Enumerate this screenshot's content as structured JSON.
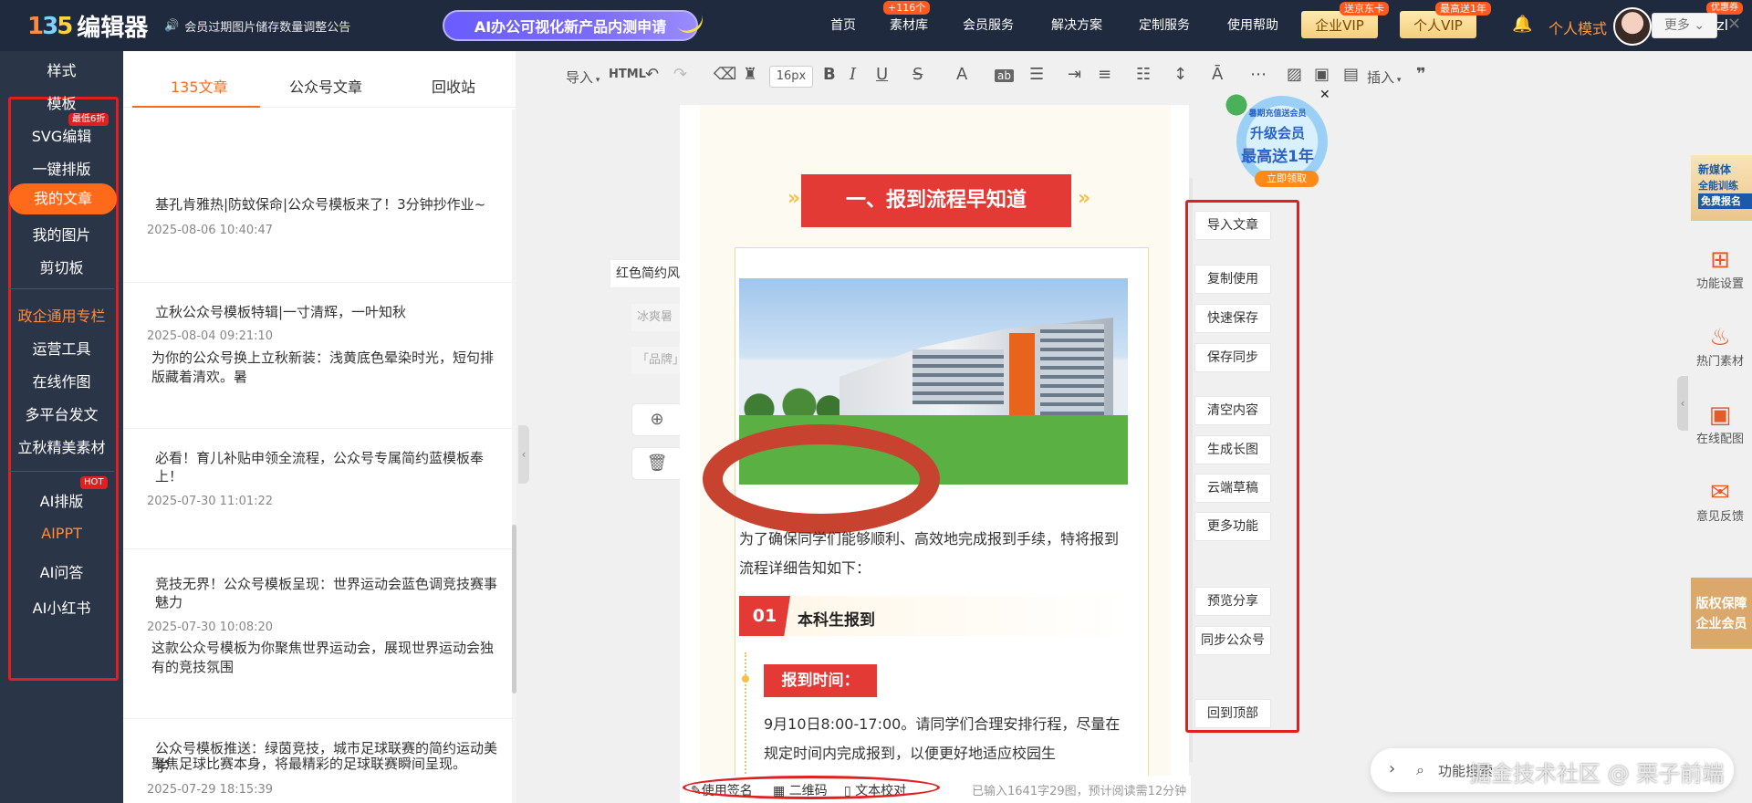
{
  "header": {
    "logo_mark": "135",
    "logo_text": "编辑器",
    "notice": "会员过期图片储存数量调整公告",
    "promo": "AI办公可视化新产品内测申请",
    "nav": [
      "首页",
      "素材库",
      "会员服务",
      "解决方案",
      "定制服务",
      "使用帮助"
    ],
    "nav_badge": "+116个",
    "vip_enterprise": "企业VIP",
    "vip_enterprise_badge": "送京东卡",
    "vip_personal": "个人VIP",
    "vip_personal_badge": "最高送1年",
    "mode": "个人模式",
    "username": "vYP_Ljzl",
    "coupon": "优惠券"
  },
  "sidebar": {
    "items": [
      "样式",
      "模板",
      "SVG编辑",
      "一键排版",
      "我的文章",
      "我的图片",
      "剪切板",
      "政企通用专栏",
      "运营工具",
      "在线作图",
      "多平台发文",
      "立秋精美素材",
      "AI排版",
      "AIPPT",
      "AI问答",
      "AI小红书"
    ],
    "svg_badge": "最低6折",
    "ai_badge": "HOT"
  },
  "articles": {
    "tabs": [
      "135文章",
      "公众号文章",
      "回收站"
    ],
    "list": [
      {
        "title": "基孔肯雅热|防蚊保命|公众号模板来了！3分钟抄作业~",
        "date": "2025-08-06 10:40:47",
        "desc": ""
      },
      {
        "title": "立秋公众号模板特辑|一寸清辉，一叶知秋",
        "date": "2025-08-04 09:21:10",
        "desc": "为你的公众号换上立秋新装：浅黄底色晕染时光，短句排版藏着清欢。暑"
      },
      {
        "title": "必看！育儿补贴申领全流程，公众号专属简约蓝模板奉上！",
        "date": "2025-07-30 11:01:22",
        "desc": ""
      },
      {
        "title": "竞技无界！公众号模板呈现：世界运动会蓝色调竞技赛事魅力",
        "date": "2025-07-30 10:08:20",
        "desc": "这款公众号模板为你聚焦世界运动会，展现世界运动会独有的竞技氛围"
      },
      {
        "title": "公众号模板推送：绿茵竞技，城市足球联赛的简约运动美学",
        "date": "2025-07-29 18:15:39",
        "desc": "聚焦足球比赛本身，将最精彩的足球联赛瞬间呈现。"
      }
    ]
  },
  "toolbar": {
    "import": "导入",
    "html": "HTML",
    "font_size": "16px",
    "insert": "插入",
    "more": "更多"
  },
  "style_panel": {
    "tag1": "红色简约风",
    "tag2": "冰爽暑",
    "tag3": "「品牌」"
  },
  "editor": {
    "section_title": "一、报到流程早知道",
    "intro": "为了确保同学们能够顺利、高效地完成报到手续，特将报到流程详细告知如下：",
    "sub_num": "01",
    "sub_title": "本科生报到",
    "time_label": "报到时间：",
    "time_text": "9月10日8:00-17:00。请同学们合理安排行程，尽量在规定时间内完成报到，以便更好地适应校园生"
  },
  "bottom": {
    "signature": "使用签名",
    "qrcode": "二维码",
    "proofread": "文本校对",
    "stats": "已输入1641字29图，预计阅读需12分钟"
  },
  "actions": [
    "导入文章",
    "复制使用",
    "快速保存",
    "保存同步",
    "清空内容",
    "生成长图",
    "云端草稿",
    "更多功能",
    "预览分享",
    "同步公众号",
    "回到顶部"
  ],
  "ad": {
    "line1": "暑期充值送会员",
    "line2": "升级会员",
    "line3": "最高送1年",
    "button": "立即领取"
  },
  "right_rail": {
    "promo_line1": "新媒体",
    "promo_line2": "全能训练",
    "promo_line3": "免费报名",
    "items": [
      "功能设置",
      "热门素材",
      "在线配图",
      "意见反馈"
    ],
    "vip_line1": "版权保障",
    "vip_line2": "企业会员"
  },
  "search": {
    "text": "功能搜索"
  },
  "watermark": "掘金技术社区 @ 栗子前端"
}
